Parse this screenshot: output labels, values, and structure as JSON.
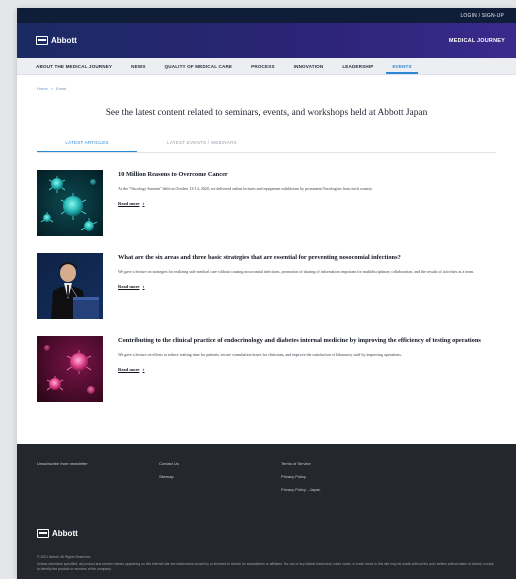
{
  "topbar": {
    "login": "LOGIN / SIGN-UP"
  },
  "brand": {
    "logo": "Abbott",
    "journey": "MEDICAL JOURNEY"
  },
  "nav": [
    {
      "label": "ABOUT THE MEDICAL JOURNEY",
      "active": false
    },
    {
      "label": "NEWS",
      "active": false
    },
    {
      "label": "QUALITY OF MEDICAL CARE",
      "active": false
    },
    {
      "label": "PROCESS",
      "active": false
    },
    {
      "label": "INNOVATION",
      "active": false
    },
    {
      "label": "LEADERSHIP",
      "active": false
    },
    {
      "label": "EVENTS",
      "active": true
    }
  ],
  "breadcrumb": {
    "home": "Home",
    "sep": ">",
    "current": "Event"
  },
  "headline": "See the latest content related to seminars, events, and workshops held at Abbott Japan",
  "tabs": {
    "latest": "LATEST ARTICLES",
    "events": "LATEST EVENTS / WEBINARS"
  },
  "articles": [
    {
      "title": "10 Million Reasons to Overcome Cancer",
      "desc": "At the \"Oncology Summit\" held on October 13-14, 2020, we delivered online lectures and equipment exhibitions by prominent Oncologists from each country.",
      "more": "Read more",
      "image": "cancer-cells-illustration"
    },
    {
      "title": "What are the six areas and three basic strategies that are essential for preventing nosocomial infections?",
      "desc": "We gave a lecture on strategies for realizing safe medical care without causing nosocomial infections, promotion of sharing of information important for multidisciplinary collaboration, and the results of activities as a team.",
      "more": "Read more",
      "image": "speaker-at-podium-photo"
    },
    {
      "title": "Contributing to the clinical practice of endocrinology and diabetes internal medicine by improving the efficiency of testing operations",
      "desc": "We gave a lecture on efforts to reduce waiting time for patients, secure consultation hours for clinicians, and improve the satisfaction of laboratory staff by improving operations.",
      "more": "Read more",
      "image": "pink-cells-illustration"
    }
  ],
  "footer": {
    "col1": [
      "Unsubscribe from newsletter"
    ],
    "col2": [
      "Contact Us",
      "Sitemap"
    ],
    "col3": [
      "Terms of Service",
      "Privacy Policy",
      "Privacy Policy - Japan"
    ],
    "logo": "Abbott",
    "copyright": "© 2021 Abbott. All Rights Reserved.",
    "legal": "Unless otherwise specified, all product and service names appearing on this Internet site are trademarks owned by or licensed to Abbott, its subsidiaries or affiliates. No use of any Abbott trademark, trade name, or trade dress in this site may be made without the prior written authorization of Abbott, except to identify the product or services of the company."
  },
  "colors": {
    "brand_dark": "#101d38",
    "brand_gradient_start": "#1b2a63",
    "brand_gradient_end": "#3a2a8c",
    "accent": "#2a88d4",
    "footer_bg": "#24272d"
  }
}
